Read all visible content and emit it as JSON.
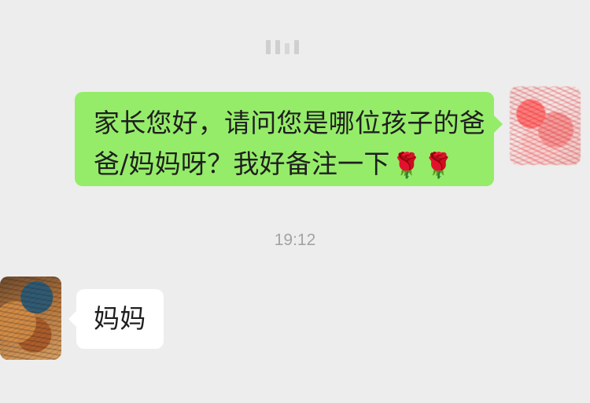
{
  "chat": {
    "messages": [
      {
        "sender": "self",
        "line1": "家长您好，请问您是哪位孩子的爸",
        "line2_prefix": "爸/妈妈呀？我好备注一下",
        "emoji": [
          "🌹",
          "🌹"
        ]
      },
      {
        "sender": "other",
        "text": "妈妈"
      }
    ],
    "timestamp": "19:12"
  },
  "colors": {
    "background": "#ededed",
    "self_bubble": "#95ec69",
    "other_bubble": "#ffffff",
    "text": "#1f1f1f",
    "timestamp": "#a3a3a3"
  },
  "icons": {
    "rose": "rose-icon"
  }
}
